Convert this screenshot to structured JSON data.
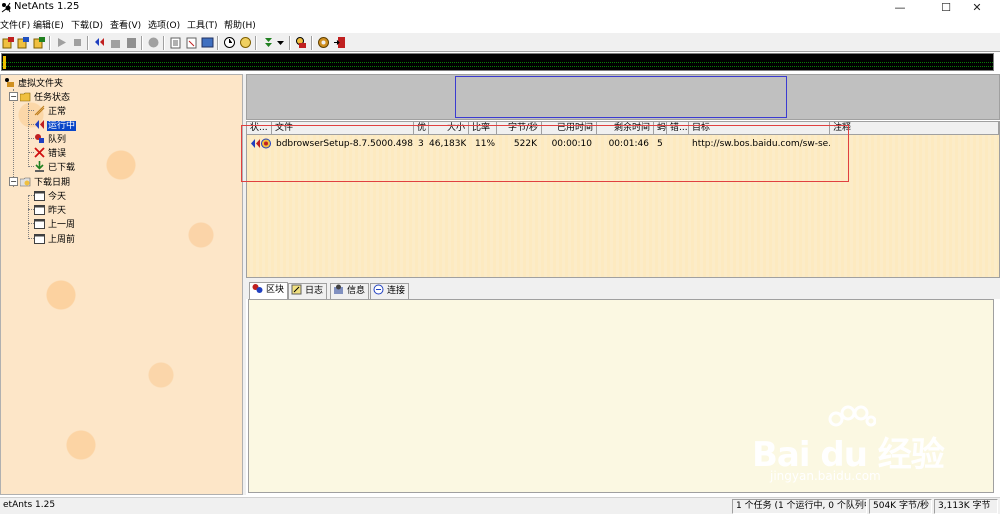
{
  "window": {
    "title": "NetAnts 1.25",
    "controls": {
      "minimize": "—",
      "maximize": "☐",
      "close": "✕"
    }
  },
  "menu": [
    "文件(F)",
    "编辑(E)",
    "下载(D)",
    "查看(V)",
    "选项(O)",
    "工具(T)",
    "帮助(H)"
  ],
  "toolbar": {
    "buttons": [
      "new-download-icon",
      "add-batch-icon",
      "import-icon",
      "start-icon",
      "stop-icon",
      "move-icon",
      "delete-icon",
      "properties-icon",
      "recycle-icon",
      "open-file-icon",
      "open-folder-icon",
      "view-icon",
      "schedule-icon",
      "speed-icon",
      "ants-icon",
      "dropdown-icon",
      "manager-icon",
      "options-icon",
      "exit-icon"
    ]
  },
  "tree": {
    "root": "虚拟文件夹",
    "status_group": "任务状态",
    "status_items": [
      "正常",
      "运行中",
      "队列",
      "错误",
      "已下载"
    ],
    "date_group": "下载日期",
    "date_items": [
      "今天",
      "昨天",
      "上一周",
      "上周前"
    ],
    "selected": "运行中"
  },
  "tasklist": {
    "columns": [
      "状...",
      "文件",
      "优",
      "大小",
      "比率",
      "字节/秒",
      "已用时间",
      "剩余时间",
      "蚂",
      "错...",
      "目标",
      "注释"
    ],
    "rows": [
      {
        "file": "bdbrowserSetup-8.7.5000.498...",
        "priority": "3",
        "size": "46,183K",
        "ratio": "11%",
        "speed": "522K",
        "elapsed": "00:00:10",
        "remaining": "00:01:46",
        "ants": "5",
        "errors": "",
        "target": "http://sw.bos.baidu.com/sw-se...",
        "note": ""
      }
    ]
  },
  "tabs": [
    "区块",
    "日志",
    "信息",
    "连接"
  ],
  "status": {
    "app": "etAnts 1.25",
    "tasks": "1 个任务 (1 个运行中, 0 个队列中)",
    "speed": "504K 字节/秒",
    "total": "3,113K 字节"
  },
  "watermark": {
    "brand": "Bai du 经验",
    "url": "jingyan.baidu.com"
  },
  "colors": {
    "selection": "#0a46c8",
    "annotation_red": "#e04040",
    "annotation_blue": "#3b3bd1",
    "tree_bg": "#fde6c8",
    "list_bg": "#fdeac0"
  }
}
